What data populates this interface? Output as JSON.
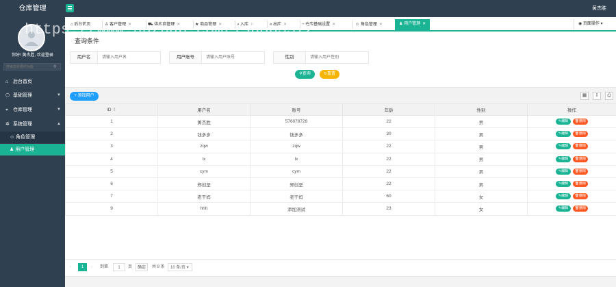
{
  "app": {
    "title": "仓库管理",
    "user_name": "黄杰胜"
  },
  "sidebar": {
    "greeting": "你好! 黄杰胜, 欢迎登录",
    "search_placeholder": "搜索您想要的功能",
    "items": [
      {
        "label": "后台首页",
        "icon": "home-icon"
      },
      {
        "label": "基础管理",
        "icon": "cube-icon"
      },
      {
        "label": "仓库管理",
        "icon": "tag-icon"
      },
      {
        "label": "系统管理",
        "icon": "gear-icon"
      }
    ],
    "subitems": [
      {
        "label": "角色管理",
        "icon": "smile-icon"
      },
      {
        "label": "用户管理",
        "icon": "user-icon"
      }
    ]
  },
  "tabs": [
    {
      "label": "后台首页",
      "icon": "home-icon"
    },
    {
      "label": "客户管理",
      "icon": "user-icon"
    },
    {
      "label": "供应商管理",
      "icon": "cart-icon"
    },
    {
      "label": "商品管理",
      "icon": "star-icon"
    },
    {
      "label": "入库",
      "icon": "double-right-icon"
    },
    {
      "label": "出库",
      "icon": "double-left-icon"
    },
    {
      "label": "仓库基础设置",
      "icon": "tag-icon"
    },
    {
      "label": "角色管理",
      "icon": "smile-icon"
    },
    {
      "label": "用户管理",
      "icon": "user-icon"
    }
  ],
  "page_op_label": "页面操作",
  "watermark": "https://www.huzhan.com/ishop3572",
  "query": {
    "title": "查询条件",
    "fields": [
      {
        "label": "用户名",
        "placeholder": "请输入用户名"
      },
      {
        "label": "用户账号",
        "placeholder": "请输入用户账号"
      },
      {
        "label": "性别",
        "placeholder": "请输入用户性别"
      }
    ],
    "search_label": "查询",
    "reset_label": "重置"
  },
  "toolbar": {
    "add_label": "添加用户"
  },
  "table": {
    "columns": [
      "ID",
      "用户名",
      "账号",
      "年龄",
      "性别",
      "操作"
    ],
    "rows": [
      [
        "1",
        "黄杰胜",
        "576078726",
        "22",
        "男"
      ],
      [
        "2",
        "钱多多",
        "钱多多",
        "30",
        "男"
      ],
      [
        "3",
        "zqw",
        "zqw",
        "22",
        "男"
      ],
      [
        "4",
        "lx",
        "lx",
        "22",
        "男"
      ],
      [
        "5",
        "cym",
        "cym",
        "22",
        "男"
      ],
      [
        "6",
        "郑创坚",
        "郑创坚",
        "22",
        "男"
      ],
      [
        "7",
        "老干妈",
        "老干妈",
        "60",
        "女"
      ],
      [
        "9",
        "hhh",
        "添加测试",
        "23",
        "女"
      ]
    ],
    "edit_label": "编辑",
    "delete_label": "删除"
  },
  "pager": {
    "current": "1",
    "goto_label": "到第",
    "goto_value": "1",
    "page_label": "页",
    "confirm_label": "确定",
    "total_label": "共 8 条",
    "page_size": "10 条/页"
  }
}
